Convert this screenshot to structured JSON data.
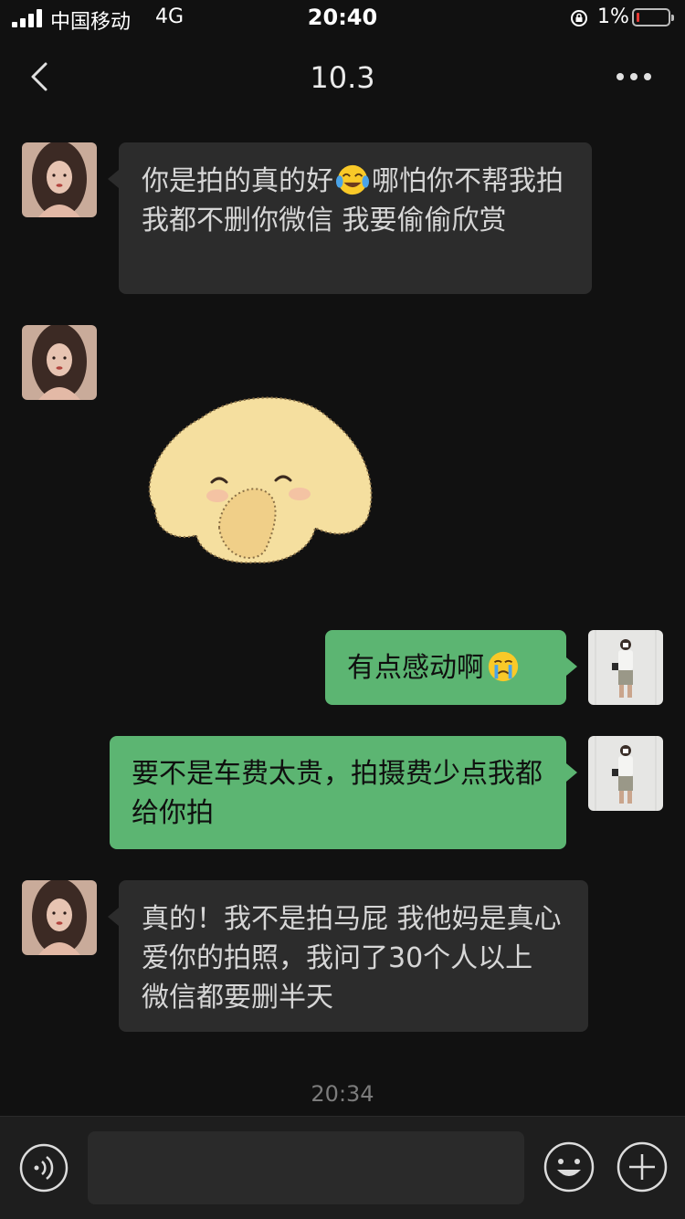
{
  "status_bar": {
    "carrier": "中国移动",
    "network": "4G",
    "time": "20:40",
    "battery_percent": "1%",
    "battery_level": 0.01,
    "battery_color": "#e53935",
    "icons": [
      "signal-icon",
      "orientation-lock-icon",
      "battery-icon"
    ]
  },
  "nav": {
    "title": "10.3",
    "icons": [
      "back-arrow-icon",
      "more-options-icon"
    ]
  },
  "messages": [
    {
      "sender": "contact",
      "type": "text",
      "text_before": "你是拍的真的好",
      "emoji": "tears-of-joy-emoji",
      "text_after": "哪怕你不帮我拍 我都不删你微信 我要偷偷欣赏"
    },
    {
      "sender": "contact",
      "type": "sticker",
      "sticker": "shy-puppy-sticker"
    },
    {
      "sender": "me",
      "type": "text",
      "text_before": "有点感动啊",
      "emoji": "crying-face-emoji",
      "text_after": ""
    },
    {
      "sender": "me",
      "type": "text",
      "text_before": "要不是车费太贵，拍摄费少点我都给你拍",
      "text_after": ""
    },
    {
      "sender": "contact",
      "type": "text",
      "text_before": "真的！我不是拍马屁 我他妈是真心爱你的拍照，我问了30个人以上 微信都要删半天",
      "text_after": ""
    }
  ],
  "timestamp": "20:34",
  "input_bar": {
    "value": "",
    "icons": [
      "voice-icon",
      "emoji-icon",
      "plus-icon"
    ]
  },
  "colors": {
    "background": "#111111",
    "incoming_bubble": "#2c2c2c",
    "outgoing_bubble": "#5cb572"
  }
}
